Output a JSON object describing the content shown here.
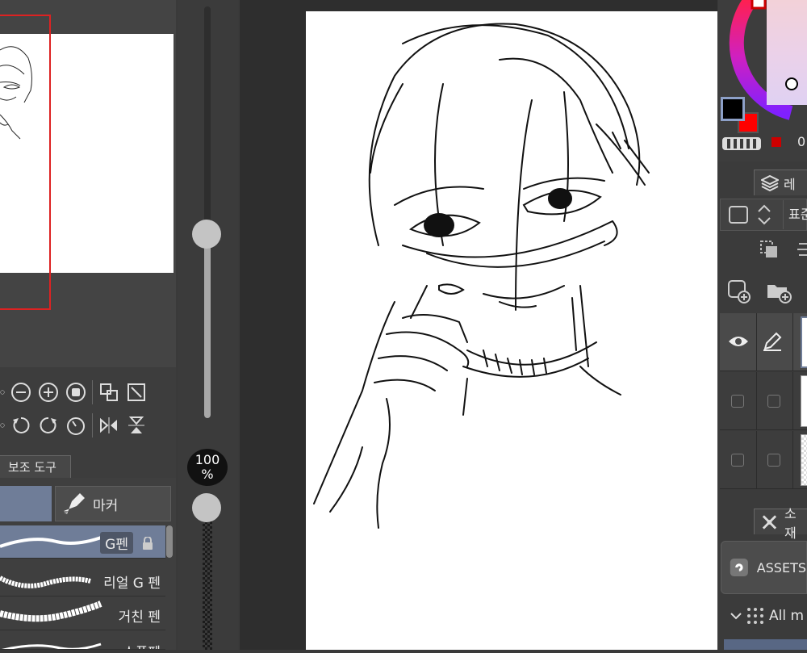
{
  "navigator": {
    "row1_icons": [
      "zoom-out-icon",
      "zoom-in-icon",
      "stop-icon",
      "fit-screen-icon",
      "actual-size-icon"
    ],
    "row2_icons": [
      "rotate-left-icon",
      "rotate-right-icon",
      "reset-rotation-icon",
      "flip-horizontal-icon",
      "flip-vertical-icon"
    ]
  },
  "subtool_panel": {
    "tab_label": "보조 도구",
    "group_marker_label": "마커",
    "brushes": [
      {
        "name": "G펜",
        "selected": true,
        "locked": true
      },
      {
        "name": "리얼 G 펜",
        "selected": false
      },
      {
        "name": "거친 펜",
        "selected": false
      },
      {
        "name": "스푼펜",
        "selected": false
      }
    ]
  },
  "zoom": {
    "value": "100",
    "unit": "%"
  },
  "colors": {
    "main_color": "#000000",
    "sub_color": "#ff0000",
    "small_swatch": "#cc0000",
    "partial_value": "0",
    "accent_selected": "#6f7d98"
  },
  "layer_panel": {
    "tab_label": "레",
    "blend_mode": "표준"
  },
  "material_panel": {
    "tab_label": "소재",
    "assets_label": "ASSETS",
    "filter_label": "All m"
  }
}
